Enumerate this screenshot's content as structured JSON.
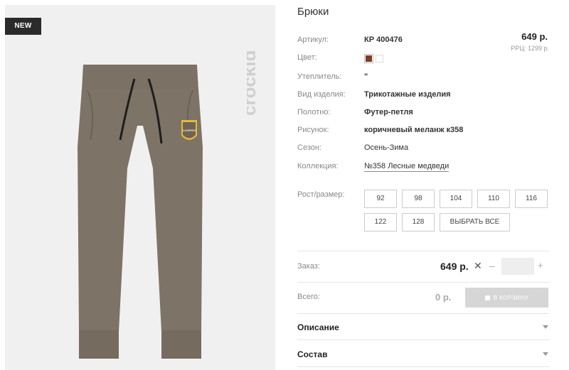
{
  "badge": "NEW",
  "brand_logo": "crockid",
  "product": {
    "title": "Брюки",
    "price": "649 р.",
    "rrp": "РРЦ: 1299 р."
  },
  "specs": {
    "article_label": "Артикул:",
    "article_value": "КР 400476",
    "color_label": "Цвет:",
    "color_hex": "#7b3e26",
    "insulation_label": "Утеплитель:",
    "insulation_value": "\"",
    "type_label": "Вид изделия:",
    "type_value": "Трикотажные изделия",
    "fabric_label": "Полотно:",
    "fabric_value": "Футер-петля",
    "pattern_label": "Рисунок:",
    "pattern_value": "коричневый меланж к358",
    "season_label": "Сезон:",
    "season_value": "Осень-Зима",
    "collection_label": "Коллекция:",
    "collection_value": "№358 Лесные медведи"
  },
  "sizes": {
    "label": "Рост/размер:",
    "options": [
      "92",
      "98",
      "104",
      "110",
      "116",
      "122",
      "128"
    ],
    "select_all": "ВЫБРАТЬ ВСЕ"
  },
  "order": {
    "label": "Заказ:",
    "price": "649 р.",
    "times": "✕",
    "minus": "–",
    "plus": "+",
    "quantity": ""
  },
  "total": {
    "label": "Всего:",
    "value": "0 р.",
    "cart_button": "В КОРЗИНУ"
  },
  "accordion": {
    "description": "Описание",
    "composition": "Состав"
  },
  "pants_art": {
    "emblem_text": "CAMPING"
  },
  "colors": {
    "pants": "#7d7366",
    "background": "#f0f0f0",
    "badge": "#2b2b2b"
  }
}
